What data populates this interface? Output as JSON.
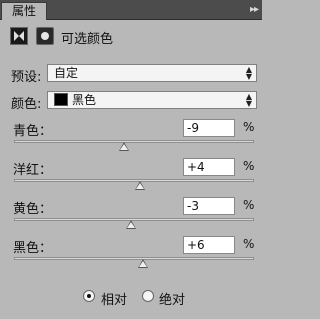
{
  "panel": {
    "tab_label": "属性",
    "menu_glyph": "▸▸"
  },
  "header": {
    "title": "可选颜色"
  },
  "preset": {
    "label": "预设:",
    "value": "自定",
    "arrows": "▲▼"
  },
  "colors": {
    "label": "颜色:",
    "value": "黑色",
    "arrows": "▲▼",
    "swatch_color": "#000000"
  },
  "sliders": [
    {
      "label": "青色：",
      "value": "-9",
      "unit": "%"
    },
    {
      "label": "洋红：",
      "value": "+4",
      "unit": "%"
    },
    {
      "label": "黄色：",
      "value": "-3",
      "unit": "%"
    },
    {
      "label": "黑色：",
      "value": "+6",
      "unit": "%"
    }
  ],
  "method": {
    "options": [
      {
        "label": "相对",
        "selected": true
      },
      {
        "label": "绝对",
        "selected": false
      }
    ]
  }
}
